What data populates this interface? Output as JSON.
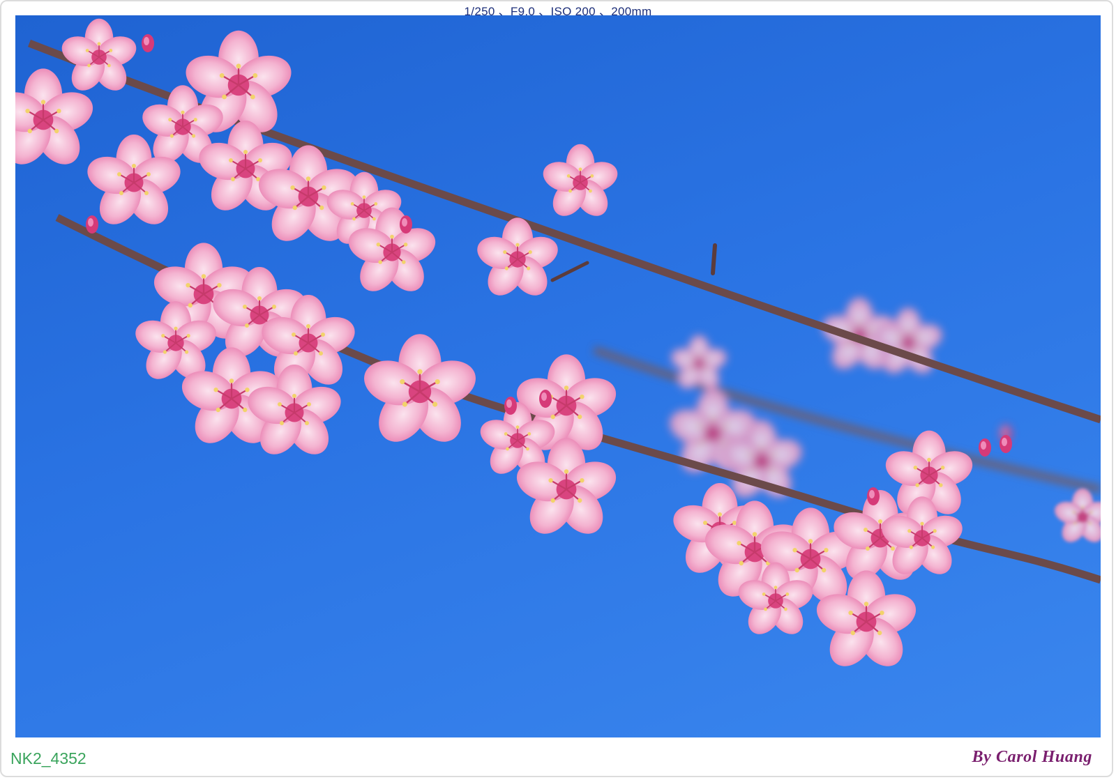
{
  "caption": {
    "exif": "1/250 、F9.0 、ISO 200 、200mm",
    "filename": "NK2_4352",
    "signature": "By Carol Huang"
  },
  "photo": {
    "subject": "",
    "colors": {
      "sky_top": "#1f63d2",
      "sky_bottom": "#3a86ee",
      "branch": "#6b4a4a",
      "blossom_light": "#f7c4dc",
      "blossom_mid": "#ee8fbe",
      "blossom_dark": "#d9447f",
      "stamen": "#c63a6b"
    }
  }
}
